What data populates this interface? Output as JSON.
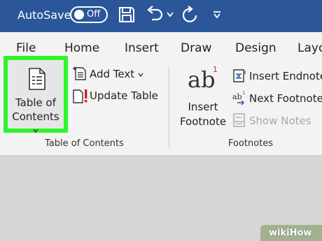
{
  "titlebar": {
    "autosave_label": "AutoSave",
    "autosave_state": "Off",
    "background_color": "#2b579a",
    "icons": [
      "save-icon",
      "undo-icon",
      "dropdown-arrow-icon",
      "redo-icon",
      "customize-qat-icon"
    ]
  },
  "tabs": [
    "File",
    "Home",
    "Insert",
    "Draw",
    "Design",
    "Layo"
  ],
  "toc_group": {
    "toc_button_line1": "Table of",
    "toc_button_line2": "Contents",
    "add_text": "Add Text",
    "update_table": "Update Table",
    "label": "Table of Contents",
    "highlight_color": "#2ef52b"
  },
  "footnotes_group": {
    "insert_footnote_line1": "Insert",
    "insert_footnote_line2": "Footnote",
    "ab_glyph": "ab",
    "ab_superscript": "1",
    "insert_endnote": "Insert Endnote",
    "next_footnote": "Next Footnote",
    "show_notes": "Show Notes",
    "label": "Footnotes"
  },
  "watermark": "wikiHow"
}
